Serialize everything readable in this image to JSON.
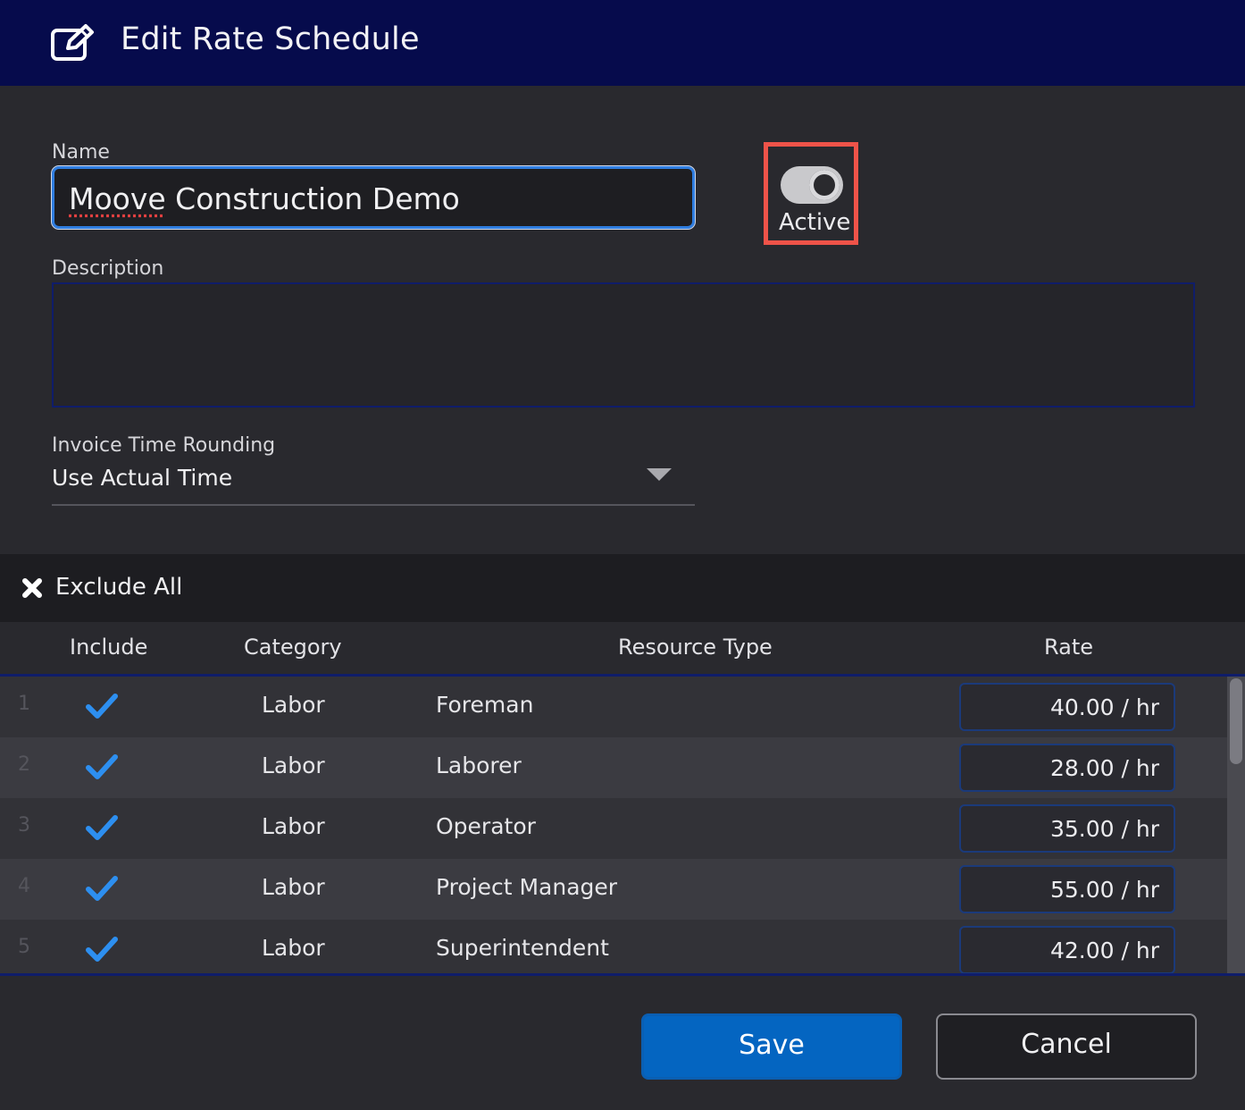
{
  "dialog": {
    "title": "Edit Rate Schedule",
    "title_icon": "edit-icon"
  },
  "form": {
    "name_label": "Name",
    "name_value": "Moove Construction Demo",
    "active_label": "Active",
    "active": true,
    "description_label": "Description",
    "description_value": "",
    "rounding_label": "Invoice Time Rounding",
    "rounding_value": "Use Actual Time"
  },
  "toolbar": {
    "exclude_all_label": "Exclude All",
    "exclude_icon": "close-icon"
  },
  "table": {
    "headers": {
      "include": "Include",
      "category": "Category",
      "resource_type": "Resource Type",
      "rate": "Rate"
    },
    "rows": [
      {
        "index": "1",
        "included": true,
        "category": "Labor",
        "resource_type": "Foreman",
        "rate": "40.00 / hr"
      },
      {
        "index": "2",
        "included": true,
        "category": "Labor",
        "resource_type": "Laborer",
        "rate": "28.00 / hr"
      },
      {
        "index": "3",
        "included": true,
        "category": "Labor",
        "resource_type": "Operator",
        "rate": "35.00 / hr"
      },
      {
        "index": "4",
        "included": true,
        "category": "Labor",
        "resource_type": "Project Manager",
        "rate": "55.00 / hr"
      },
      {
        "index": "5",
        "included": true,
        "category": "Labor",
        "resource_type": "Superintendent",
        "rate": "42.00 / hr"
      }
    ]
  },
  "buttons": {
    "save": "Save",
    "cancel": "Cancel"
  },
  "colors": {
    "header_bg": "#060b4c",
    "accent": "#0465c1",
    "check": "#2d8ff0",
    "highlight": "#ef5349"
  }
}
